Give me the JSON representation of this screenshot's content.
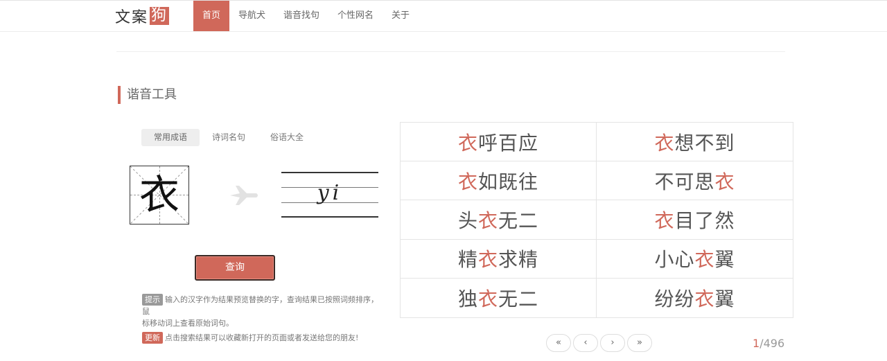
{
  "logo": {
    "text": "文案",
    "box": "狗"
  },
  "nav": [
    {
      "label": "首页",
      "active": true
    },
    {
      "label": "导航犬",
      "active": false
    },
    {
      "label": "谐音找句",
      "active": false
    },
    {
      "label": "个性网名",
      "active": false
    },
    {
      "label": "关于",
      "active": false
    }
  ],
  "section": {
    "title": "谐音工具"
  },
  "tabs": [
    {
      "label": "常用成语",
      "active": true
    },
    {
      "label": "诗词名句",
      "active": false
    },
    {
      "label": "俗语大全",
      "active": false
    }
  ],
  "input": {
    "character": "衣",
    "pinyin": "yi"
  },
  "query_button": "查询",
  "tips": {
    "hint_badge": "提示",
    "hint_line1": "输入的汉字作为结果预览替换的字，查询结果已按照词频排序，鼠",
    "hint_line2": "标移动词上查看原始词句。",
    "update_badge": "更新",
    "update_text": "点击搜索结果可以收藏新打开的页面或者发送给您的朋友!"
  },
  "results": [
    {
      "pre": "",
      "hl": "衣",
      "post": "呼百应"
    },
    {
      "pre": "",
      "hl": "衣",
      "post": "想不到"
    },
    {
      "pre": "",
      "hl": "衣",
      "post": "如既往"
    },
    {
      "pre": "不可思",
      "hl": "衣",
      "post": ""
    },
    {
      "pre": "头",
      "hl": "衣",
      "post": "无二"
    },
    {
      "pre": "",
      "hl": "衣",
      "post": "目了然"
    },
    {
      "pre": "精",
      "hl": "衣",
      "post": "求精"
    },
    {
      "pre": "小心",
      "hl": "衣",
      "post": "翼"
    },
    {
      "pre": "独",
      "hl": "衣",
      "post": "无二"
    },
    {
      "pre": "纷纷",
      "hl": "衣",
      "post": "翼"
    }
  ],
  "pagination": {
    "first": "«",
    "prev": "‹",
    "next": "›",
    "last": "»",
    "current": "1",
    "total": "/496"
  },
  "colors": {
    "accent": "#d0685a",
    "text": "#555555",
    "border": "#e4e4e4"
  }
}
